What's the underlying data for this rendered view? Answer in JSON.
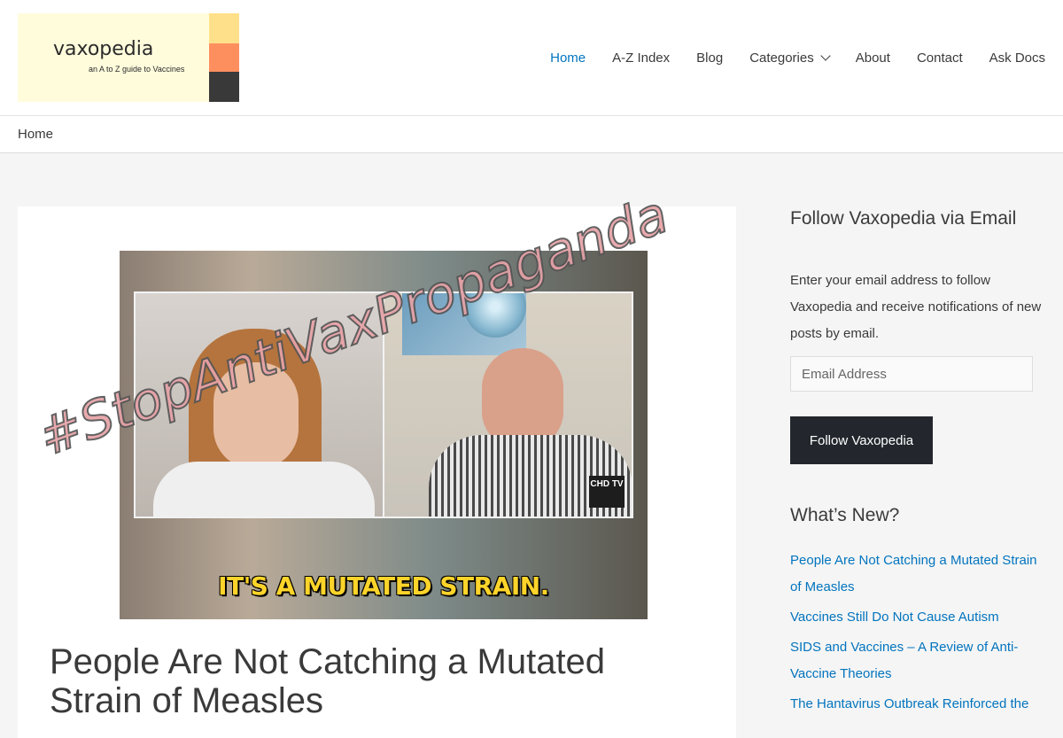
{
  "header": {
    "logo": {
      "name": "vaxopedia",
      "tagline": "an A to Z guide to Vaccines",
      "colors": [
        "#fffcdc",
        "#ffe08a",
        "#fd8f5f",
        "#393939"
      ]
    },
    "nav": [
      {
        "label": "Home",
        "active": true
      },
      {
        "label": "A-Z Index"
      },
      {
        "label": "Blog"
      },
      {
        "label": "Categories",
        "has_dropdown": true
      },
      {
        "label": "About"
      },
      {
        "label": "Contact"
      },
      {
        "label": "Ask Docs"
      }
    ]
  },
  "breadcrumb": {
    "current": "Home"
  },
  "article": {
    "image": {
      "caption": "IT'S A MUTATED STRAIN.",
      "watermark": "#StopAntiVaxPropaganda",
      "channel_bug": "CHD TV"
    },
    "title": "People Are Not Catching a Mutated Strain of Measles"
  },
  "sidebar": {
    "follow": {
      "title": "Follow Vaxopedia via Email",
      "description": "Enter your email address to follow Vaxopedia and receive notifications of new posts by email.",
      "input_placeholder": "Email Address",
      "button_label": "Follow Vaxopedia"
    },
    "whats_new": {
      "title": "What’s New?",
      "items": [
        "People Are Not Catching a Mutated Strain of Measles",
        "Vaccines Still Do Not Cause Autism",
        "SIDS and Vaccines – A Review of Anti-Vaccine Theories",
        "The Hantavirus Outbreak Reinforced the"
      ]
    }
  },
  "colors": {
    "accent": "#0274be",
    "button": "#23272d",
    "text": "#3a3a3a"
  }
}
